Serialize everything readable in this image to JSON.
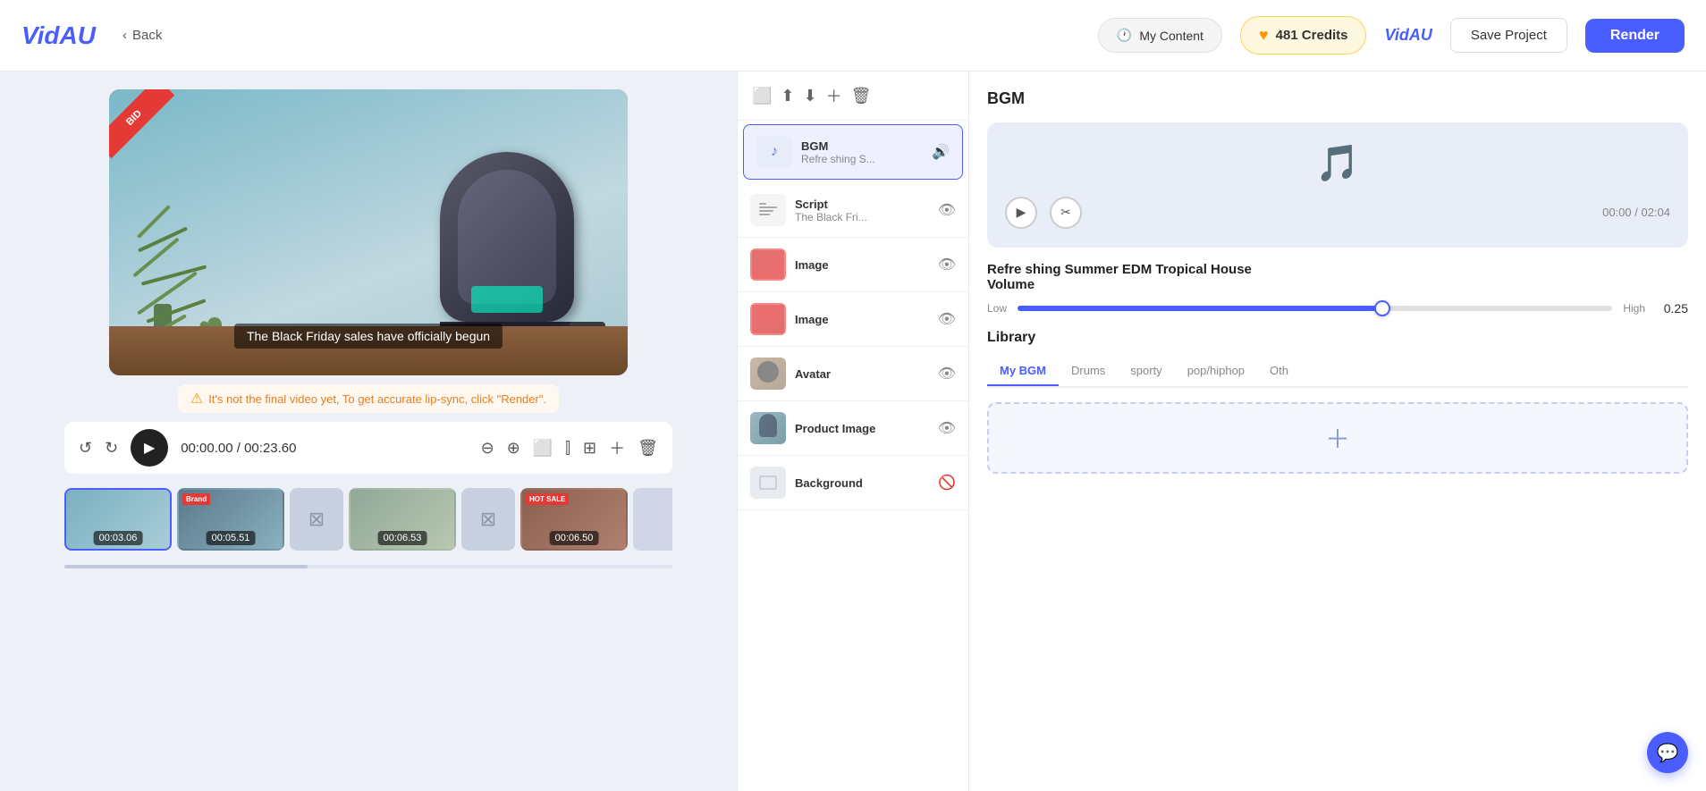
{
  "header": {
    "logo": "VidAU",
    "back_label": "Back",
    "my_content_label": "My Content",
    "credits_label": "481 Credits",
    "vidau_small_label": "VidAU",
    "save_label": "Save Project",
    "render_label": "Render"
  },
  "preview": {
    "badge_text": "BID",
    "subtitle": "The Black Friday sales have officially begun",
    "warning": "It's not the final video yet, To get accurate lip-sync, click \"Render\".",
    "time_current": "00:00.00",
    "time_total": "00:23.60"
  },
  "thumbnails": [
    {
      "time": "00:03.06",
      "active": true,
      "type": "product"
    },
    {
      "time": "00:05.51",
      "active": false,
      "type": "product2"
    },
    {
      "time": "",
      "active": false,
      "type": "icon"
    },
    {
      "time": "00:06.53",
      "active": false,
      "type": "product3"
    },
    {
      "time": "",
      "active": false,
      "type": "icon"
    },
    {
      "time": "00:06.50",
      "active": false,
      "type": "sale"
    },
    {
      "time": "",
      "active": false,
      "type": "dark"
    }
  ],
  "layers": [
    {
      "id": "bgm",
      "name": "BGM",
      "sub": "Refre shing S...",
      "type": "music",
      "active": true,
      "visible": true
    },
    {
      "id": "script",
      "name": "Script",
      "sub": "The Black Fri...",
      "type": "script",
      "active": false,
      "visible": true
    },
    {
      "id": "image1",
      "name": "Image",
      "sub": "",
      "type": "image",
      "active": false,
      "visible": true
    },
    {
      "id": "image2",
      "name": "Image",
      "sub": "",
      "type": "image",
      "active": false,
      "visible": true
    },
    {
      "id": "avatar",
      "name": "Avatar",
      "sub": "",
      "type": "avatar",
      "active": false,
      "visible": true
    },
    {
      "id": "product",
      "name": "Product Image",
      "sub": "",
      "type": "product",
      "active": false,
      "visible": true
    },
    {
      "id": "background",
      "name": "Background",
      "sub": "",
      "type": "background",
      "active": false,
      "visible": false
    }
  ],
  "bgm_panel": {
    "title": "BGM",
    "track_name": "Refre shing Summer EDM Tropical House",
    "time": "00:00 / 02:04",
    "volume_label": "Volume",
    "volume_value": "0.25",
    "volume_low": "Low",
    "volume_high": "High",
    "library_title": "Library",
    "tabs": [
      "My BGM",
      "Drums",
      "sporty",
      "pop/hiphop",
      "Oth"
    ]
  }
}
